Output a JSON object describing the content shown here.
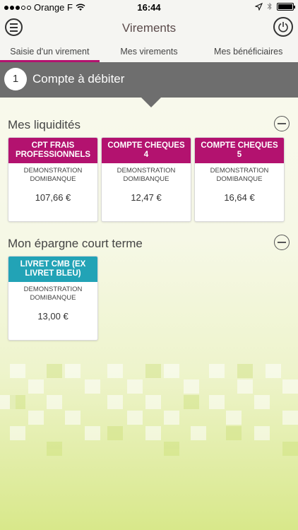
{
  "status_bar": {
    "carrier": "Orange F",
    "time": "16:44"
  },
  "header": {
    "title": "Virements"
  },
  "tabs": [
    {
      "label": "Saisie d'un virement",
      "active": true
    },
    {
      "label": "Mes virements",
      "active": false
    },
    {
      "label": "Mes bénéficiaires",
      "active": false
    }
  ],
  "step": {
    "number": "1",
    "label": "Compte à débiter"
  },
  "sections": [
    {
      "title": "Mes liquidités",
      "accounts": [
        {
          "name": "CPT FRAIS PROFESSIONNELS",
          "owner": "DEMONSTRATION DOMIBANQUE",
          "amount": "107,66 €",
          "color": "#b3126f"
        },
        {
          "name": "COMPTE CHEQUES 4",
          "owner": "DEMONSTRATION DOMIBANQUE",
          "amount": "12,47 €",
          "color": "#b3126f"
        },
        {
          "name": "COMPTE CHEQUES 5",
          "owner": "DEMONSTRATION DOMIBANQUE",
          "amount": "16,64 €",
          "color": "#b3126f"
        }
      ]
    },
    {
      "title": "Mon épargne court terme",
      "accounts": [
        {
          "name": "LIVRET CMB (EX LIVRET BLEU)",
          "owner": "DEMONSTRATION DOMIBANQUE",
          "amount": "13,00 €",
          "color": "#22a3b6"
        }
      ]
    }
  ],
  "colors": {
    "accent": "#b3126f",
    "savings": "#22a3b6",
    "step_bar": "#6e6e6e"
  }
}
